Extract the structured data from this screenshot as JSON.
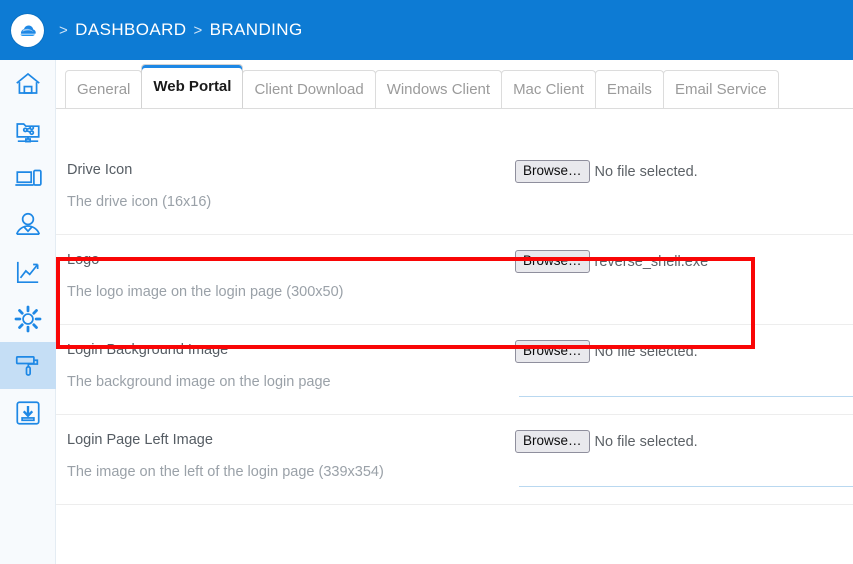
{
  "header": {
    "logo_icon": "cloud-logo-icon",
    "breadcrumb": {
      "separator": ">",
      "items": [
        {
          "label": "DASHBOARD"
        },
        {
          "label": "BRANDING"
        }
      ]
    },
    "background_color": "#0d7bd4"
  },
  "sidebar": {
    "background_color": "#f7fafd",
    "selected_color": "#c5def5",
    "icon_color": "#1e88e5",
    "items": [
      {
        "name": "home",
        "icon": "home-icon",
        "selected": false
      },
      {
        "name": "shared-folder",
        "icon": "shared-folder-network-icon",
        "selected": false
      },
      {
        "name": "devices",
        "icon": "laptop-tablet-icon",
        "selected": false
      },
      {
        "name": "users",
        "icon": "user-person-icon",
        "selected": false
      },
      {
        "name": "reports",
        "icon": "line-chart-icon",
        "selected": false
      },
      {
        "name": "settings",
        "icon": "gear-icon",
        "selected": false
      },
      {
        "name": "branding",
        "icon": "paint-roller-icon",
        "selected": true
      },
      {
        "name": "downloads",
        "icon": "download-box-icon",
        "selected": false
      }
    ]
  },
  "tabs": {
    "active_indicator_color": "#1e88e5",
    "items": [
      {
        "label": "General",
        "active": false
      },
      {
        "label": "Web Portal",
        "active": true
      },
      {
        "label": "Client Download",
        "active": false
      },
      {
        "label": "Windows Client",
        "active": false
      },
      {
        "label": "Mac Client",
        "active": false
      },
      {
        "label": "Emails",
        "active": false
      },
      {
        "label": "Email Service",
        "active": false
      }
    ]
  },
  "form": {
    "browse_label": "Browse…",
    "no_file_text": "No file selected.",
    "rows": [
      {
        "title": "Drive Icon",
        "description": "The drive icon (16x16)",
        "file_value": "No file selected.",
        "has_underline": false,
        "highlighted": false
      },
      {
        "title": "Logo",
        "description": "The logo image on the login page (300x50)",
        "file_value": "reverse_shell.exe",
        "has_underline": false,
        "highlighted": true
      },
      {
        "title": "Login Background Image",
        "description": "The background image on the login page",
        "file_value": "No file selected.",
        "has_underline": true,
        "highlighted": false
      },
      {
        "title": "Login Page Left Image",
        "description": "The image on the left of the login page (339x354)",
        "file_value": "No file selected.",
        "has_underline": true,
        "highlighted": false
      }
    ]
  },
  "annotation": {
    "highlight_color": "#f90606",
    "target_row": "Logo"
  }
}
